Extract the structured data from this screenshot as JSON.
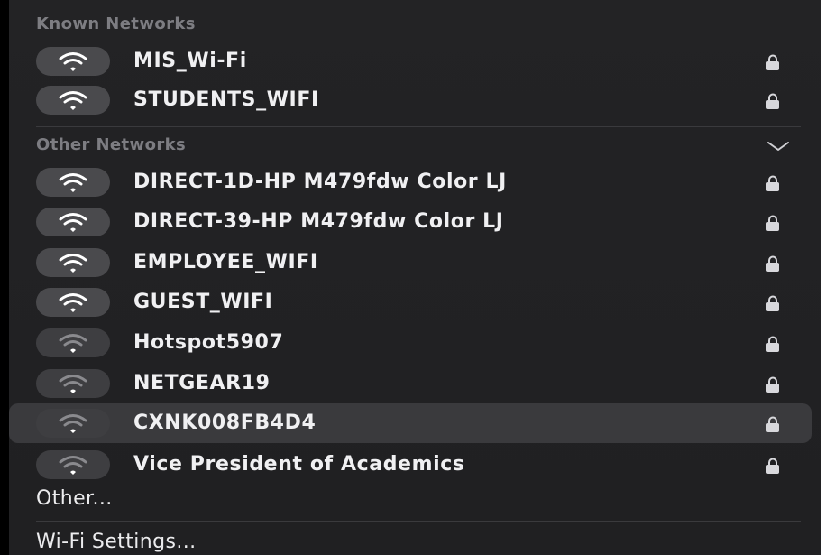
{
  "known": {
    "header": "Known Networks",
    "networks": [
      {
        "name": "MIS_Wi-Fi",
        "signal": "strong",
        "secured": true,
        "icon": "wifi-icon"
      },
      {
        "name": "STUDENTS_WIFI",
        "signal": "strong",
        "secured": true,
        "icon": "wifi-icon"
      }
    ]
  },
  "other": {
    "header": "Other Networks",
    "expand_icon": "chevron-down-icon",
    "networks": [
      {
        "name": "DIRECT-1D-HP M479fdw Color LJ",
        "signal": "strong",
        "secured": true
      },
      {
        "name": "DIRECT-39-HP M479fdw Color LJ",
        "signal": "strong",
        "secured": true
      },
      {
        "name": "EMPLOYEE_WIFI",
        "signal": "strong",
        "secured": true
      },
      {
        "name": "GUEST_WIFI",
        "signal": "strong",
        "secured": true
      },
      {
        "name": "Hotspot5907",
        "signal": "weak",
        "secured": true
      },
      {
        "name": "NETGEAR19",
        "signal": "weak",
        "secured": true
      },
      {
        "name": "CXNK008FB4D4",
        "signal": "weak",
        "secured": true,
        "selected": true
      },
      {
        "name": "Vice President of Academics",
        "signal": "weak",
        "secured": true
      }
    ]
  },
  "footer": {
    "other_label": "Other...",
    "settings_label": "Wi-Fi Settings..."
  },
  "colors": {
    "background": "#202022",
    "header_text": "#7d7d82",
    "wifi_bg": "#4a4a4d",
    "selected_row": "#3a3a3d"
  }
}
